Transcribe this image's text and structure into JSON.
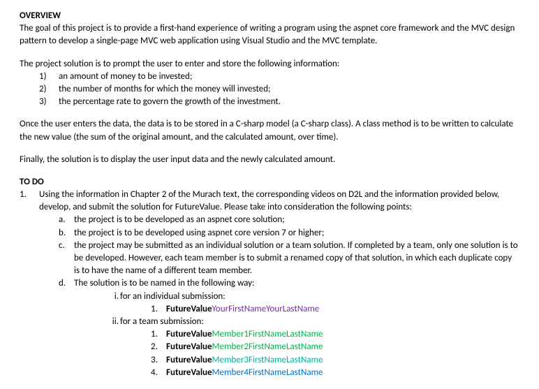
{
  "overview_heading": "OVERVIEW",
  "overview_p1": "The goal of this project is to provide a first-hand experience of writing a program using the aspnet core framework and the MVC design pattern to develop a single-page MVC web application using Visual Studio and the MVC template.",
  "overview_p2": "The project solution is to prompt the user to enter and store the following information:",
  "overview_list": [
    "an amount of money to be invested;",
    "the number of months for which the money will invested;",
    "the percentage rate to govern the growth of the investment."
  ],
  "overview_p3": "Once the user enters the data, the data is to be stored in a C-sharp model (a C-sharp class). A class method is to be written to calculate the new value (the sum of the original amount, and the calculated amount, over time).",
  "overview_p4": "Finally, the solution is to display the user input data and the newly calculated amount.",
  "todo_heading": "TO DO",
  "todo_item1": "Using the information in Chapter 2 of the Murach text, the corresponding videos on D2L and the information provided below, develop, and submit the solution for FutureValue. Please take into consideration the following points:",
  "todo_sub": {
    "a": "the project is to be developed as an aspnet core solution;",
    "b": "the project is to be developed using aspnet core version 7 or higher;",
    "c": "the project may be submitted as an individual solution or a team solution. If completed by a team, only one solution is to be developed. However, each team member is to submit a renamed copy of that solution, in which each duplicate copy is to have the name of a different team member.",
    "d": "The solution is to be named in the following way:"
  },
  "naming": {
    "individual_label": "for an individual submission:",
    "individual_prefix": "FutureValue",
    "individual_suffix": "YourFirstNameYourLastName",
    "team_label": "for a team submission:",
    "team_prefix": "FutureValue",
    "team": [
      {
        "text": "Member1FirstNameLastName"
      },
      {
        "text": "Member2FirstNameLastName"
      },
      {
        "text": "Member3FirstNameLastName"
      },
      {
        "text": "Member4FirstNameLastName"
      }
    ]
  }
}
